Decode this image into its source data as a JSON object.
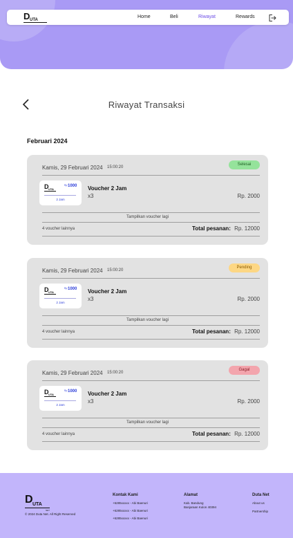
{
  "nav": {
    "logo_letter": "D",
    "logo_text": "UTA",
    "links": [
      "Home",
      "Beli",
      "Riwayat",
      "Rewards"
    ],
    "active_link": "Riwayat"
  },
  "page": {
    "title": "Riwayat Transaksi",
    "month": "Februari 2024"
  },
  "transactions": [
    {
      "date": "Kamis, 29 Februari 2024",
      "time": "15:00:20",
      "status": "Selesai",
      "voucher": {
        "currency": "Rp",
        "amount": "1000",
        "duration": "2 Jam"
      },
      "product": "Voucher 2 Jam",
      "qty": "x3",
      "price": "Rp. 2000",
      "more_label": "Tampilkan voucher lagi",
      "others": "4 voucher lainnya",
      "total_label": "Total pesanan:",
      "total_value": "Rp. 12000"
    },
    {
      "date": "Kamis, 29 Februari 2024",
      "time": "15:00:20",
      "status": "Pending",
      "voucher": {
        "currency": "Rp",
        "amount": "1000",
        "duration": "2 Jam"
      },
      "product": "Voucher 2 Jam",
      "qty": "x3",
      "price": "Rp. 2000",
      "more_label": "Tampilkan voucher lagi",
      "others": "4 voucher lainnya",
      "total_label": "Total pesanan:",
      "total_value": "Rp. 12000"
    },
    {
      "date": "Kamis, 29 Februari 2024",
      "time": "15:00:20",
      "status": "Gagal",
      "voucher": {
        "currency": "Rp",
        "amount": "1000",
        "duration": "2 Jam"
      },
      "product": "Voucher 2 Jam",
      "qty": "x3",
      "price": "Rp. 2000",
      "more_label": "Tampilkan voucher lagi",
      "others": "4 voucher lainnya",
      "total_label": "Total pesanan:",
      "total_value": "Rp. 12000"
    }
  ],
  "status_colors": {
    "Selesai": "#95e39b",
    "Pending": "#fdd784",
    "Gagal": "#f3a5ad"
  },
  "footer": {
    "logo_letter": "D",
    "logo_text": "UTA",
    "logo_sub": "NET",
    "copyright": "© 2024 Duta Net. All Right Reserved",
    "contact": {
      "title": "Kontak Kami",
      "items": [
        "+6285xxxxx - Abi Baenuri",
        "+6285xxxxx - Abi Baenuri",
        "+6285xxxxx - Abi Baenuri"
      ]
    },
    "address": {
      "title": "Alamat",
      "lines": [
        "Kab. Bandung",
        "Banjaraan Kulon 40394"
      ]
    },
    "dutanet": {
      "title": "Duta Net",
      "items": [
        "About us",
        "Partnership"
      ]
    }
  },
  "colors": {
    "brand": "#a99af5",
    "footer": "#c2b5fb",
    "active_link": "#6b4de6",
    "card": "#e2e2e2"
  },
  "icons": {
    "back": "chevron-left-icon",
    "logout": "logout-icon"
  }
}
